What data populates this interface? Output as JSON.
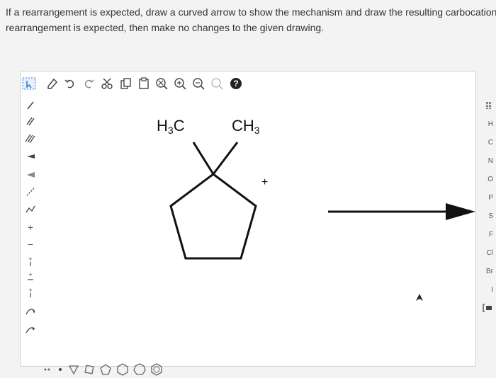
{
  "question": {
    "line1": "If a rearrangement is expected, draw a curved arrow to show the mechanism and draw the resulting carbocation. If",
    "line2": "rearrangement is expected, then make no changes to the given drawing."
  },
  "toolbar": {
    "items": [
      "select-tool-icon",
      "eraser-icon",
      "undo-icon",
      "redo-icon",
      "cut-icon",
      "copy-icon",
      "paste-icon",
      "zoom-fit-icon",
      "zoom-in-icon",
      "zoom-out-icon",
      "search-icon",
      "help-icon"
    ]
  },
  "molecule": {
    "left_group": "H3C",
    "left_main": "H",
    "left_sub": "3",
    "left_tail": "C",
    "right_group": "CH3",
    "right_main": "CH",
    "right_sub": "3",
    "charge": "+"
  },
  "left_tools": {
    "plus_label": "+",
    "minus_label": "−"
  },
  "elements": [
    "H",
    "C",
    "N",
    "O",
    "P",
    "S",
    "F",
    "Cl",
    "Br",
    "I"
  ],
  "colors": {
    "accent": "#2a7bd5",
    "arrow": "#111111"
  }
}
